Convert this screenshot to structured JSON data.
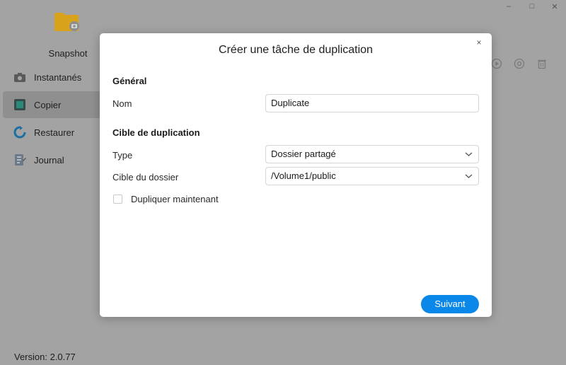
{
  "app": {
    "name": "Snapshot",
    "version": "Version: 2.0.77",
    "nav": [
      {
        "label": "Instantanés",
        "icon": "camera-icon"
      },
      {
        "label": "Copier",
        "icon": "copy-icon"
      },
      {
        "label": "Restaurer",
        "icon": "restore-icon"
      },
      {
        "label": "Journal",
        "icon": "log-icon"
      }
    ],
    "active_nav": "Copier",
    "window_controls": {
      "minimize": "–",
      "maximize": "□",
      "close": "✕"
    }
  },
  "dialog": {
    "title": "Créer une tâche de duplication",
    "close_symbol": "×",
    "general_section": "Général",
    "name_label": "Nom",
    "name_value": "Duplicate",
    "target_section": "Cible de duplication",
    "type_label": "Type",
    "type_value": "Dossier partagé",
    "folder_label": "Cible du dossier",
    "folder_value": "/Volume1/public",
    "duplicate_now_label": "Dupliquer maintenant",
    "duplicate_now_checked": false,
    "next_button": "Suivant"
  },
  "colors": {
    "accent": "#0a88ea",
    "overlay": "#a3a3a3"
  }
}
